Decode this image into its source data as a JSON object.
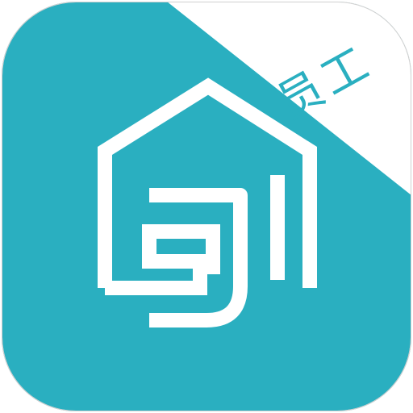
{
  "app_icon": {
    "badge_text": "员工",
    "icons": {
      "house": "house-icon",
      "logo_mark": "logo-mark-icon"
    },
    "colors": {
      "primary": "#2aafc0",
      "foreground": "#ffffff",
      "badge_background": "#ffffff"
    }
  }
}
